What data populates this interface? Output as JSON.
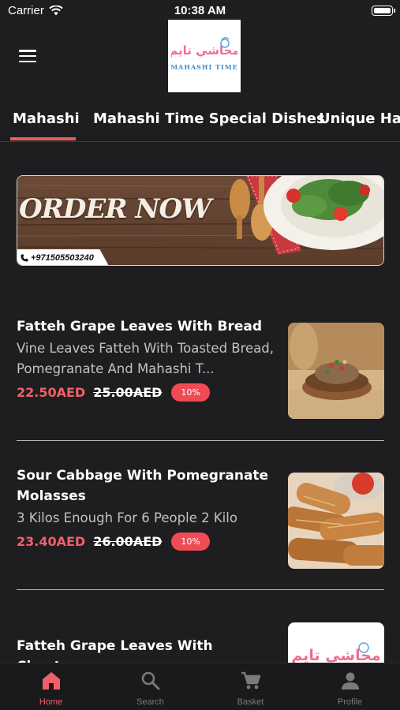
{
  "status": {
    "carrier": "Carrier",
    "time": "10:38 AM"
  },
  "logo": {
    "arabic": "محاشي تايم",
    "latin": "MAHASHI TIME"
  },
  "tabs": [
    {
      "label": "Mahashi",
      "active": true
    },
    {
      "label": "Mahashi Time Special Dishes"
    },
    {
      "label": "Unique Hav"
    }
  ],
  "banner": {
    "title": "ORDER NOW",
    "phone": "+971505503240"
  },
  "products": [
    {
      "name": "Fatteh Grape Leaves With Bread",
      "description": "Vine Leaves Fatteh With Toasted Bread, Pomegranate And Mahashi T...",
      "price": "22.50AED",
      "old_price": "25.00AED",
      "discount": "10%"
    },
    {
      "name": "Sour Cabbage With Pomegranate Molasses",
      "description": "3 Kilos Enough For 6 People 2 Kilo",
      "price": "23.40AED",
      "old_price": "26.00AED",
      "discount": "10%"
    },
    {
      "name": "Fatteh Grape Leaves With Cheetos"
    }
  ],
  "nav": [
    {
      "label": "Home",
      "icon": "home-icon",
      "active": true
    },
    {
      "label": "Search",
      "icon": "search-icon"
    },
    {
      "label": "Basket",
      "icon": "cart-icon"
    },
    {
      "label": "Profile",
      "icon": "person-icon"
    }
  ],
  "colors": {
    "accent": "#f0606a",
    "background": "#1e1e20",
    "discount_badge": "#f04b55"
  }
}
